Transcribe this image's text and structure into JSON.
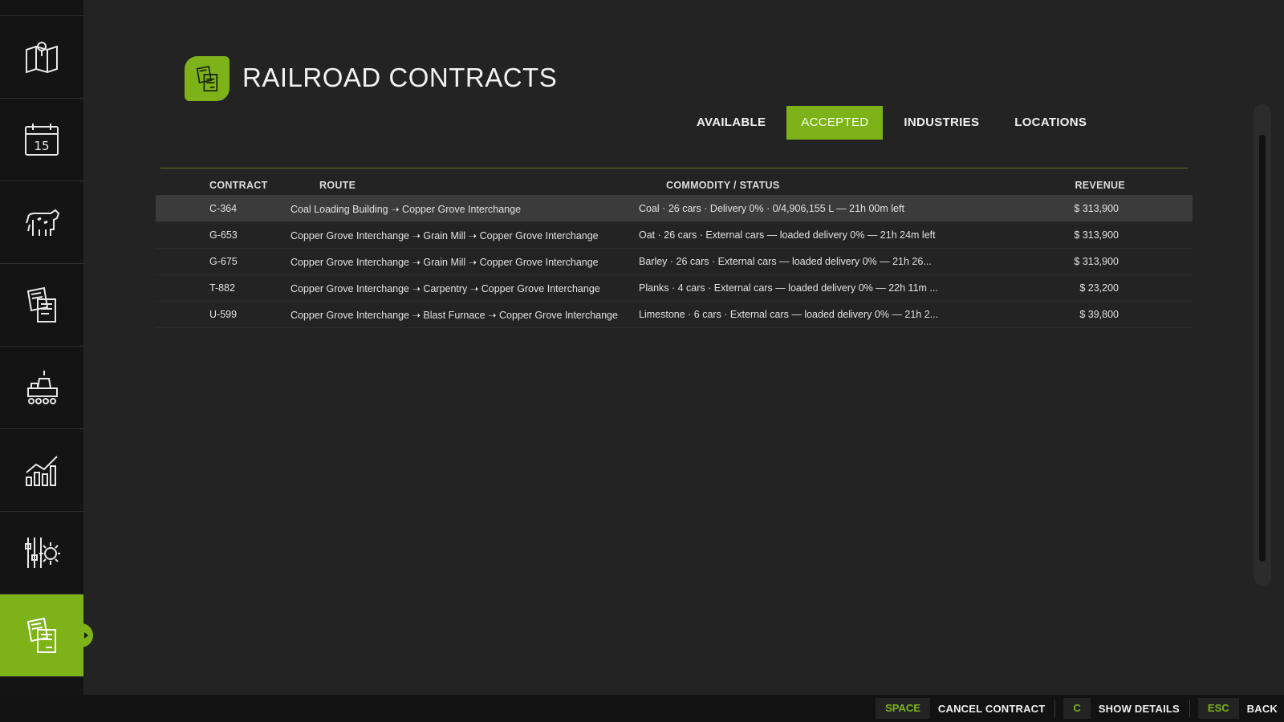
{
  "page": {
    "title": "RAILROAD CONTRACTS",
    "icon": "contracts-icon",
    "accent_color": "#7db319"
  },
  "sidebar": {
    "items": [
      {
        "icon": "map-icon",
        "active": false
      },
      {
        "icon": "calendar-icon",
        "label": "15",
        "active": false
      },
      {
        "icon": "cow-icon",
        "active": false
      },
      {
        "icon": "documents-icon",
        "active": false
      },
      {
        "icon": "production-icon",
        "active": false
      },
      {
        "icon": "statistics-icon",
        "active": false
      },
      {
        "icon": "settings-icon",
        "active": false
      },
      {
        "icon": "contracts-icon",
        "active": true
      }
    ]
  },
  "tabs": [
    {
      "label": "AVAILABLE",
      "active": false
    },
    {
      "label": "ACCEPTED",
      "active": true
    },
    {
      "label": "INDUSTRIES",
      "active": false
    },
    {
      "label": "LOCATIONS",
      "active": false
    }
  ],
  "table": {
    "headers": {
      "contract": "CONTRACT",
      "route": "ROUTE",
      "commodity": "COMMODITY / STATUS",
      "revenue": "REVENUE"
    },
    "rows": [
      {
        "contract": "C-364",
        "route": "Coal Loading Building ➝ Copper Grove Interchange",
        "commodity": "Coal · 26 cars · Delivery 0% · 0/4,906,155 L — 21h 00m left",
        "revenue": "$ 313,900",
        "selected": true
      },
      {
        "contract": "G-653",
        "route": "Copper Grove Interchange ➝ Grain Mill ➝ Copper Grove Interchange",
        "commodity": "Oat · 26 cars · External cars — loaded delivery 0% — 21h 24m left",
        "revenue": "$ 313,900",
        "selected": false
      },
      {
        "contract": "G-675",
        "route": "Copper Grove Interchange ➝ Grain Mill ➝ Copper Grove Interchange",
        "commodity": "Barley · 26 cars · External cars — loaded delivery 0% — 21h 26...",
        "revenue": "$ 313,900",
        "selected": false
      },
      {
        "contract": "T-882",
        "route": "Copper Grove Interchange ➝ Carpentry ➝ Copper Grove Interchange",
        "commodity": "Planks · 4 cars · External cars — loaded delivery 0% — 22h 11m ...",
        "revenue": "$ 23,200",
        "selected": false
      },
      {
        "contract": "U-599",
        "route": "Copper Grove Interchange ➝ Blast Furnace ➝ Copper Grove Interchange",
        "commodity": "Limestone · 6 cars · External cars — loaded delivery 0% — 21h 2...",
        "revenue": "$ 39,800",
        "selected": false
      }
    ]
  },
  "footer": {
    "hints": [
      {
        "key": "SPACE",
        "label": "CANCEL CONTRACT"
      },
      {
        "key": "C",
        "label": "SHOW DETAILS"
      },
      {
        "key": "ESC",
        "label": "BACK"
      }
    ]
  }
}
